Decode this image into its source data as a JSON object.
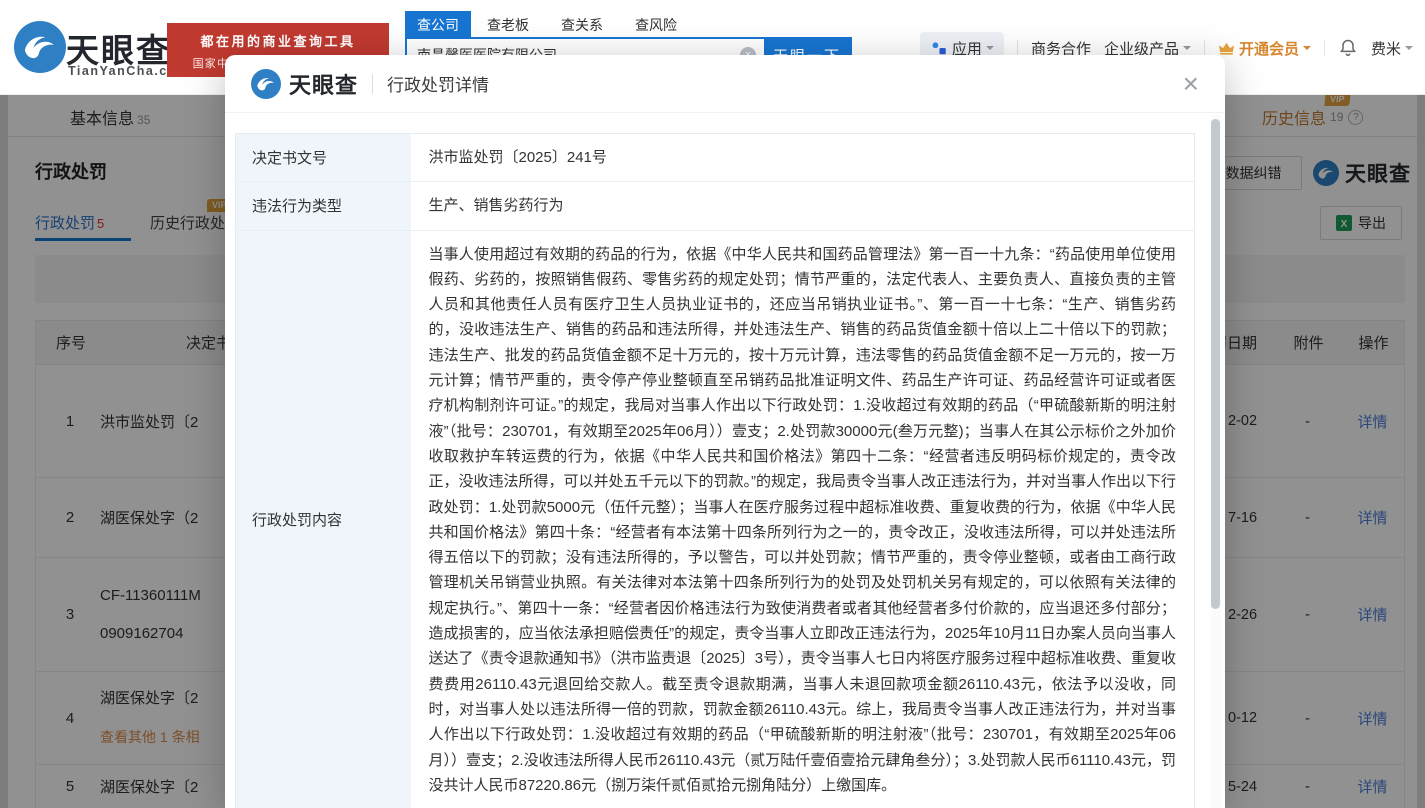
{
  "colors": {
    "accent_blue": "#1775d1",
    "banner_red": "#c13a30",
    "vip_orange": "#e3a23f",
    "link_blue": "#4a7fd9",
    "link_orange": "#d98b4a"
  },
  "icons": {
    "close_glyph": "×",
    "clear_glyph": "×",
    "help_glyph": "?",
    "excel_glyph": "X"
  },
  "header": {
    "logo": {
      "brand": "天眼查",
      "domain": "TianYanCha.com"
    },
    "banner": {
      "line1": "都在用的商业查询工具",
      "line2": "国家中小企业发展基金旗下机构"
    },
    "search": {
      "tabs": [
        {
          "label": "查公司"
        },
        {
          "label": "查老板"
        },
        {
          "label": "查关系"
        },
        {
          "label": "查风险"
        }
      ],
      "value": "南昌馨医医院有限公司",
      "button": "天眼一下"
    },
    "nav": {
      "apps": "应用",
      "cooperation": "商务合作",
      "enterprise": "企业级产品",
      "vip": "开通会员",
      "username": "费米"
    }
  },
  "page": {
    "tabs": {
      "basic": {
        "label": "基本信息",
        "count": "35"
      },
      "history": {
        "label": "历史信息",
        "count": "19",
        "vip": "VIP"
      }
    },
    "section": {
      "title": "行政处罚",
      "correction": "数据纠错",
      "watermark": "天眼查",
      "export": "导出"
    },
    "sub_tabs": {
      "active": {
        "label": "行政处罚",
        "count": "5"
      },
      "history": {
        "label": "历史行政处罚",
        "vip": "VIP"
      }
    },
    "table": {
      "headers": {
        "no": "序号",
        "doc": "决定书文号",
        "date": "处罚日期",
        "attachment": "附件",
        "action": "操作"
      },
      "rows": [
        {
          "no": "1",
          "doc": "洪市监处罚〔2",
          "date": "2-02",
          "attachment": "-",
          "action": "详情"
        },
        {
          "no": "2",
          "doc": "湖医保处字（2",
          "date": "7-16",
          "attachment": "-",
          "action": "详情"
        },
        {
          "no": "3",
          "doc": "CF-11360111M",
          "doc2": "0909162704",
          "date": "2-26",
          "attachment": "-",
          "action": "详情"
        },
        {
          "no": "4",
          "doc": "湖医保处字〔2",
          "more": "查看其他 1 条相",
          "date": "0-12",
          "attachment": "-",
          "action": "详情"
        },
        {
          "no": "5",
          "doc": "湖医保处字〔2",
          "date": "5-24",
          "attachment": "-",
          "action": "详情"
        }
      ]
    }
  },
  "modal": {
    "brand": "天眼查",
    "title": "行政处罚详情",
    "rows": {
      "doc_no": {
        "label": "决定书文号",
        "value": "洪市监处罚〔2025〕241号"
      },
      "type": {
        "label": "违法行为类型",
        "value": "生产、销售劣药行为"
      },
      "content": {
        "label": "行政处罚内容",
        "value": "当事人使用超过有效期的药品的行为，依据《中华人民共和国药品管理法》第一百一十九条：“药品使用单位使用假药、劣药的，按照销售假药、零售劣药的规定处罚；情节严重的，法定代表人、主要负责人、直接负责的主管人员和其他责任人员有医疗卫生人员执业证书的，还应当吊销执业证书。”、第一百一十七条：“生产、销售劣药的，没收违法生产、销售的药品和违法所得，并处违法生产、销售的药品货值金额十倍以上二十倍以下的罚款；违法生产、批发的药品货值金额不足十万元的，按十万元计算，违法零售的药品货值金额不足一万元的，按一万元计算；情节严重的，责令停产停业整顿直至吊销药品批准证明文件、药品生产许可证、药品经营许可证或者医疗机构制剂许可证。”的规定，我局对当事人作出以下行政处罚：1.没收超过有效期的药品（“甲硫酸新斯的明注射液”（批号：230701，有效期至2025年06月））壹支；2.处罚款30000元(叁万元整)；当事人在其公示标价之外加价收取救护车转运费的行为，依据《中华人民共和国价格法》第四十二条：“经营者违反明码标价规定的，责令改正，没收违法所得，可以并处五千元以下的罚款。”的规定，我局责令当事人改正违法行为，并对当事人作出以下行政处罚：1.处罚款5000元（伍仟元整）；当事人在医疗服务过程中超标准收费、重复收费的行为，依据《中华人民共和国价格法》第四十条：“经营者有本法第十四条所列行为之一的，责令改正，没收违法所得，可以并处违法所得五倍以下的罚款；没有违法所得的，予以警告，可以并处罚款；情节严重的，责令停业整顿，或者由工商行政管理机关吊销营业执照。有关法律对本法第十四条所列行为的处罚及处罚机关另有规定的，可以依照有关法律的规定执行。”、第四十一条：“经营者因价格违法行为致使消费者或者其他经营者多付价款的，应当退还多付部分；造成损害的，应当依法承担赔偿责任”的规定，责令当事人立即改正违法行为，2025年10月11日办案人员向当事人送达了《责令退款通知书》（洪市监责退〔2025〕3号），责令当事人七日内将医疗服务过程中超标准收费、重复收费费用26110.43元退回给交款人。截至责令退款期满，当事人未退回款项金额26110.43元，依法予以没收，同时，对当事人处以违法所得一倍的罚款，罚款金额26110.43元。综上，我局责令当事人改正违法行为，并对当事人作出以下行政处罚：1.没收超过有效期的药品（“甲硫酸新斯的明注射液”（批号：230701，有效期至2025年06月））壹支；2.没收违法所得人民币26110.43元（贰万陆仟壹佰壹拾元肆角叁分）；3.处罚款人民币61110.43元，罚没共计人民币87220.86元（捌万柒仟贰佰贰拾元捌角陆分）上缴国库。"
      }
    }
  }
}
